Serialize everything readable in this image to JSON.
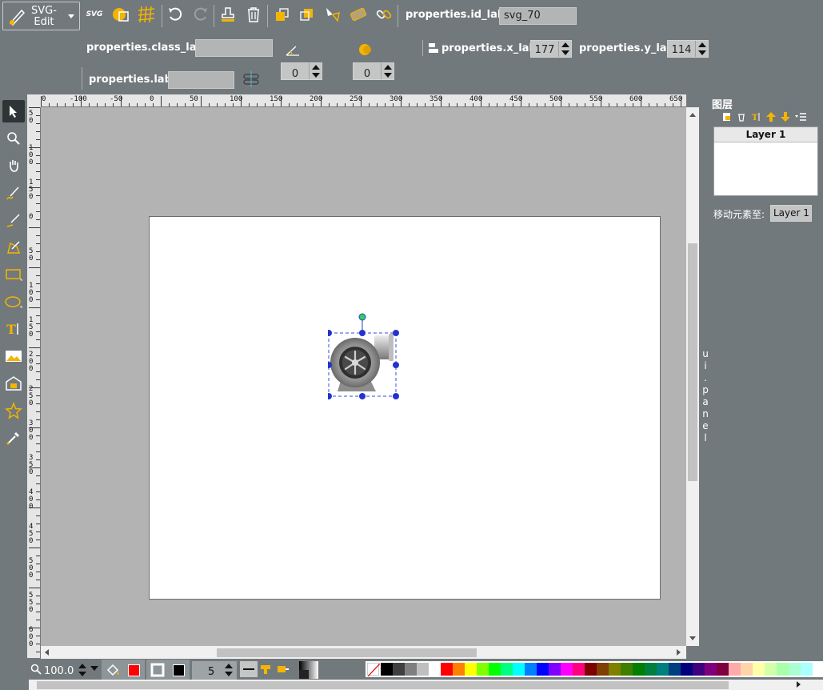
{
  "app": {
    "logo_line1": "SVG-",
    "logo_line2": "Edit"
  },
  "toolbar_top": {
    "id_label": "properties.id_label",
    "id_value": "svg_70",
    "svg_text": "SVG"
  },
  "toolbar_second": {
    "class_label": "properties.class_label",
    "class_value": "",
    "x_label": "properties.x_label",
    "x_value": "177",
    "y_label": "properties.y_label",
    "y_value": "114"
  },
  "toolbar_third": {
    "label_label": "properties.label",
    "label_value": "",
    "angle_value": "0",
    "blur_value": "0"
  },
  "rulers": {
    "top": [
      "0",
      "-100",
      "-50",
      "0",
      "50",
      "100",
      "150",
      "200",
      "250",
      "300",
      "350",
      "400",
      "450",
      "500",
      "550",
      "600",
      "650"
    ],
    "left": [
      "50",
      "100",
      "150",
      "0",
      "50",
      "100",
      "150",
      "200",
      "250",
      "300",
      "350",
      "400",
      "450",
      "500",
      "550",
      "600"
    ]
  },
  "layers_panel": {
    "title": "图层",
    "layer_name": "Layer 1",
    "move_to_label": "移动元素至:",
    "move_to_value": "Layer 1",
    "collapsed_label": "ui.panel"
  },
  "bottom": {
    "zoom_value": "100.0",
    "stroke_width": "5",
    "fill_color": "#ff0000",
    "stroke_color": "#000000"
  },
  "palette": [
    "#000000",
    "#3f3f3f",
    "#7f7f7f",
    "#bfbfbf",
    "#ffffff",
    "#ff0000",
    "#ff7f00",
    "#ffff00",
    "#7fff00",
    "#00ff00",
    "#00ff7f",
    "#00ffff",
    "#007fff",
    "#0000ff",
    "#7f00ff",
    "#ff00ff",
    "#ff007f",
    "#7f0000",
    "#7f3f00",
    "#7f7f00",
    "#3f7f00",
    "#007f00",
    "#007f3f",
    "#007f7f",
    "#003f7f",
    "#00007f",
    "#3f007f",
    "#7f007f",
    "#7f003f",
    "#ffaaaa",
    "#ffd4aa",
    "#ffffaa",
    "#d4ffaa",
    "#aaffaa",
    "#aaffd4",
    "#aaffff"
  ]
}
